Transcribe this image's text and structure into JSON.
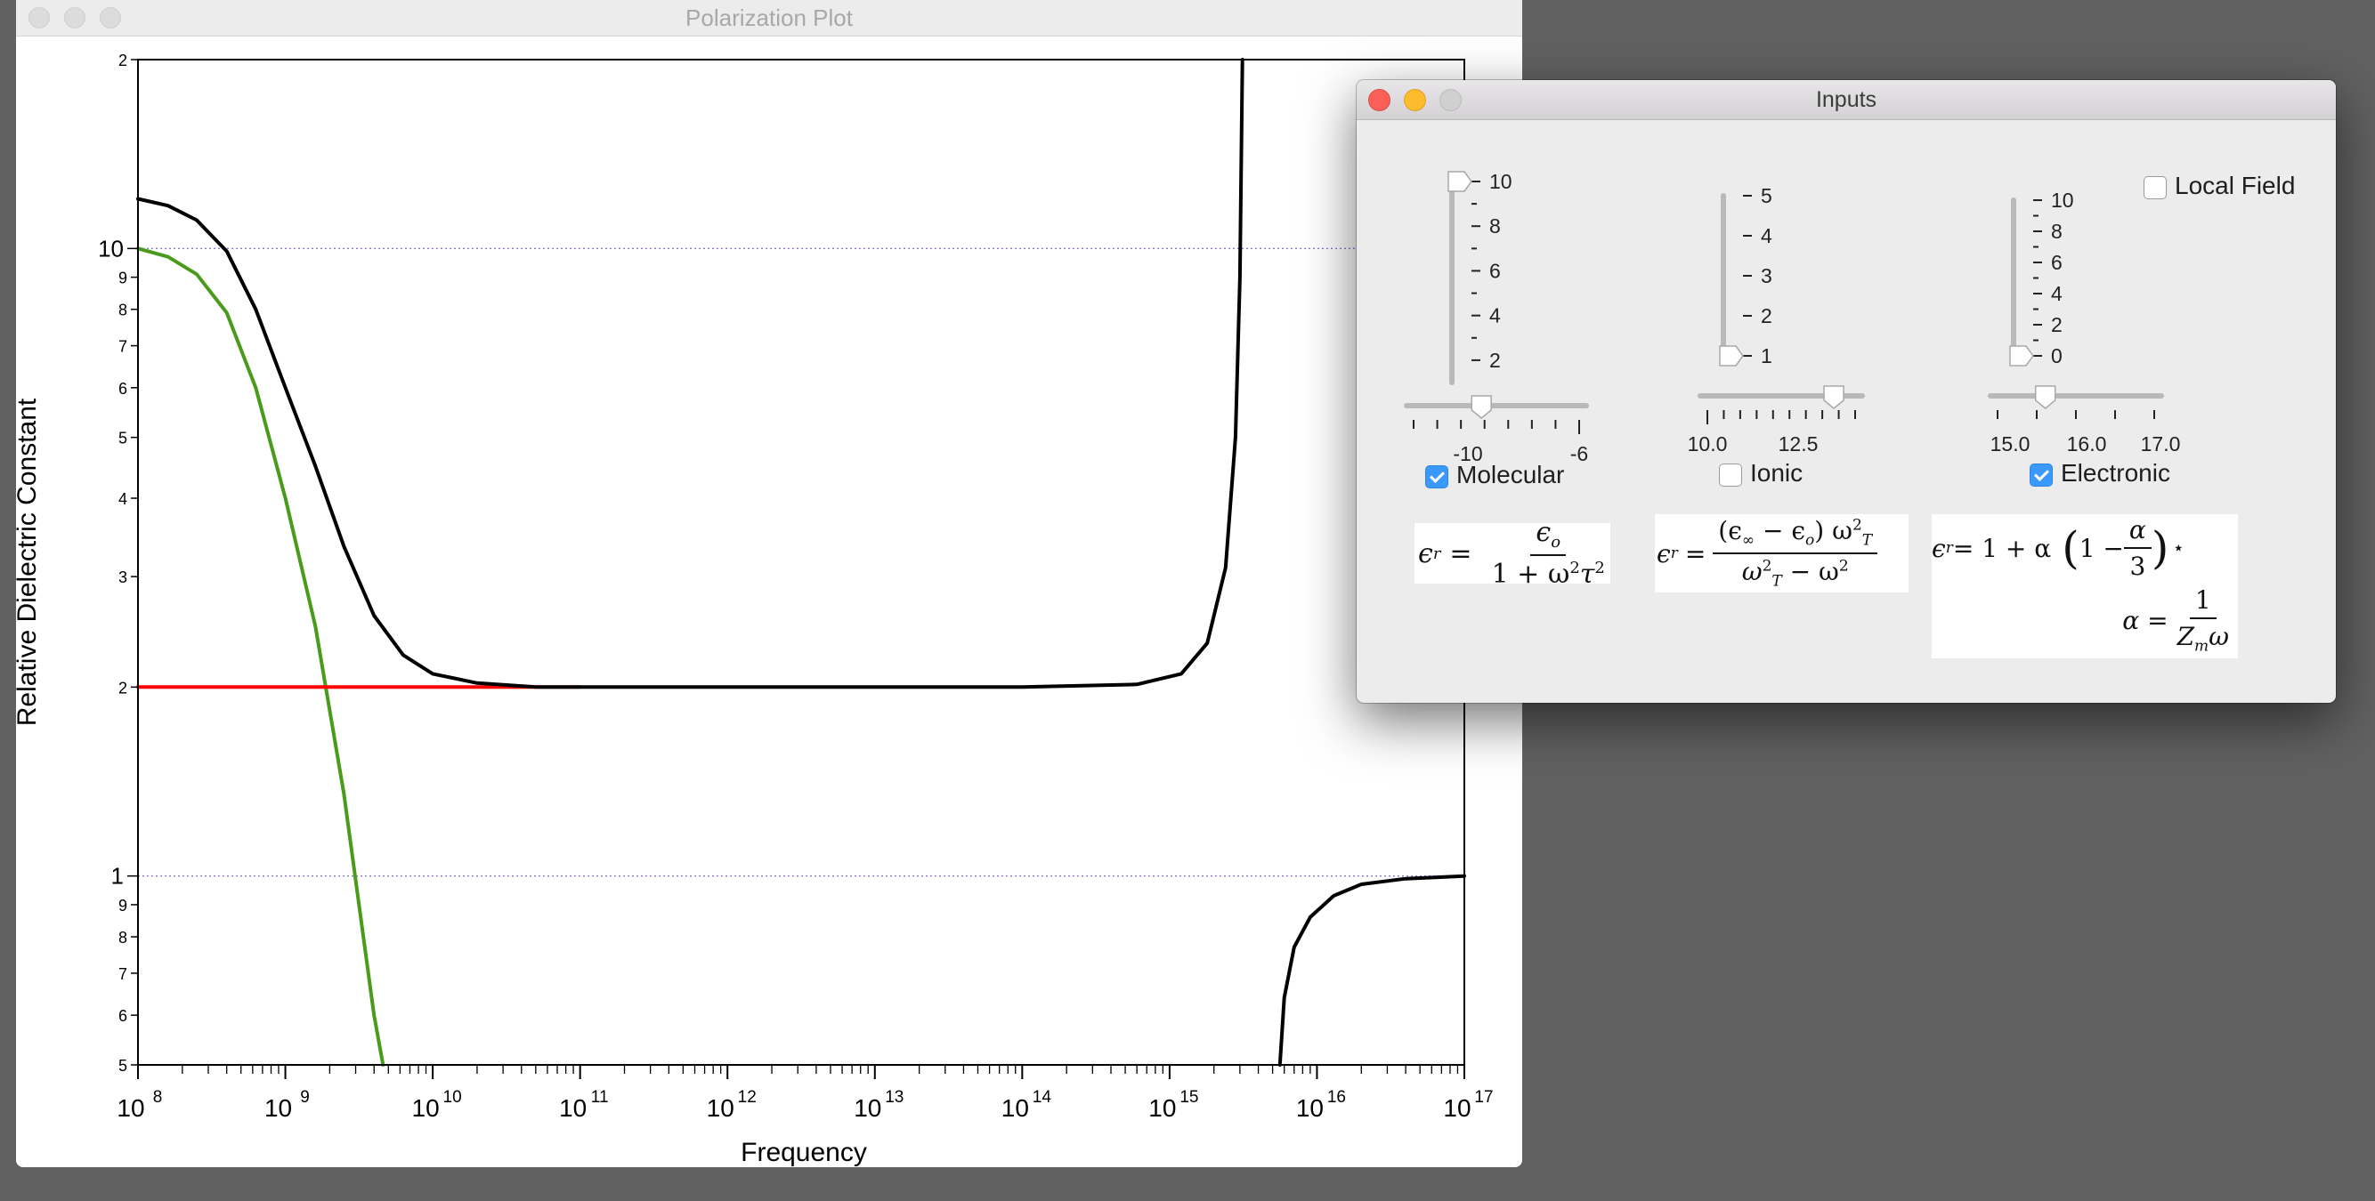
{
  "plot_window": {
    "title": "Polarization Plot",
    "chart_data": {
      "type": "line",
      "xlabel": "Frequency",
      "ylabel": "Relative Dielectric Constant",
      "x_scale": "log",
      "y_scale": "log",
      "xlim": [
        100000000.0,
        1e+17
      ],
      "ylim": [
        0.5,
        20
      ],
      "x_tick_labels": [
        {
          "base": "10",
          "exp": "8"
        },
        {
          "base": "10",
          "exp": "9"
        },
        {
          "base": "10",
          "exp": "10"
        },
        {
          "base": "10",
          "exp": "11"
        },
        {
          "base": "10",
          "exp": "12"
        },
        {
          "base": "10",
          "exp": "13"
        },
        {
          "base": "10",
          "exp": "14"
        },
        {
          "base": "10",
          "exp": "15"
        },
        {
          "base": "10",
          "exp": "16"
        },
        {
          "base": "10",
          "exp": "17"
        }
      ],
      "y_tick_labels": [
        "2",
        "10",
        "9",
        "8",
        "7",
        "6",
        "5",
        "4",
        "3",
        "2",
        "1",
        "9",
        "8",
        "7",
        "6",
        "5"
      ],
      "y_gridlines": [
        10,
        1
      ],
      "series": [
        {
          "color": "#4a9a1c",
          "points": [
            [
              100000000.0,
              10
            ],
            [
              160000000.0,
              9.7
            ],
            [
              250000000.0,
              9.1
            ],
            [
              400000000.0,
              7.9
            ],
            [
              630000000.0,
              6.0
            ],
            [
              1000000000.0,
              4.0
            ],
            [
              1600000000.0,
              2.5
            ],
            [
              2500000000.0,
              1.35
            ],
            [
              4000000000.0,
              0.6
            ],
            [
              4600000000.0,
              0.5
            ]
          ]
        },
        {
          "color": "#ff0000",
          "points": [
            [
              100000000.0,
              2.0
            ],
            [
              30000000000.0,
              2.0
            ],
            [
              100000000000.0,
              2.0
            ]
          ]
        },
        {
          "color": "#000000",
          "points": [
            [
              100000000.0,
              12.0
            ],
            [
              160000000.0,
              11.7
            ],
            [
              250000000.0,
              11.1
            ],
            [
              400000000.0,
              9.9
            ],
            [
              630000000.0,
              8.0
            ],
            [
              1000000000.0,
              6.0
            ],
            [
              1600000000.0,
              4.5
            ],
            [
              2500000000.0,
              3.35
            ],
            [
              4000000000.0,
              2.6
            ],
            [
              6300000000.0,
              2.25
            ],
            [
              10000000000.0,
              2.1
            ],
            [
              20000000000.0,
              2.03
            ],
            [
              50000000000.0,
              2.0
            ],
            [
              100000000000000.0,
              2.0
            ],
            [
              600000000000000.0,
              2.02
            ],
            [
              1200000000000000.0,
              2.1
            ],
            [
              1800000000000000.0,
              2.35
            ],
            [
              2400000000000000.0,
              3.1
            ],
            [
              2800000000000000.0,
              5.0
            ],
            [
              3000000000000000.0,
              9.0
            ],
            [
              3120000000000000.0,
              20.0
            ]
          ]
        },
        {
          "color": "#000000",
          "points": [
            [
              5600000000000000.0,
              0.5
            ],
            [
              6000000000000000.0,
              0.64
            ],
            [
              7000000000000000.0,
              0.77
            ],
            [
              9000000000000000.0,
              0.86
            ],
            [
              1.3e+16,
              0.93
            ],
            [
              2e+16,
              0.97
            ],
            [
              4e+16,
              0.99
            ],
            [
              1e+17,
              1.0
            ]
          ]
        }
      ]
    }
  },
  "inputs_window": {
    "title": "Inputs",
    "colors": {
      "close": "#fc5f57",
      "minimize": "#fdbc2e",
      "zoom": "#d0d0d0",
      "checkbox_checked": "#3b99fc"
    },
    "molecular": {
      "label": "Molecular",
      "checked": true,
      "vslider_ticks": [
        "10",
        "8",
        "6",
        "4",
        "2"
      ],
      "vslider_value": 10,
      "hslider_ticks": [
        "-10",
        "-6"
      ],
      "hslider_value": -9.5,
      "equation": {
        "lhs": "ϵ",
        "lhs_sub": "r",
        "eq": "=",
        "num": "ϵ",
        "num_sub": "o",
        "den_a": "1 + ω",
        "den_sup": "2",
        "den_b": "τ",
        "den_sup2": "2"
      }
    },
    "ionic": {
      "label": "Ionic",
      "checked": false,
      "vslider_ticks": [
        "5",
        "4",
        "3",
        "2",
        "1"
      ],
      "vslider_value": 1,
      "hslider_ticks": [
        "10.0",
        "12.5"
      ],
      "hslider_value": 13.2,
      "equation": {
        "lhs": "ϵ",
        "lhs_sub": "r",
        "eq": "=",
        "num_a": "(ϵ",
        "num_sub1": "∞",
        "num_b": " − ϵ",
        "num_sub2": "o",
        "num_c": ") ω",
        "num_sup": "2",
        "num_sub3": "T",
        "den_a": "ω",
        "den_sup": "2",
        "den_sub": "T",
        "den_b": " − ω",
        "den_sup2": "2"
      }
    },
    "electronic": {
      "label": "Electronic",
      "checked": true,
      "vslider_ticks": [
        "10",
        "8",
        "6",
        "4",
        "2",
        "0"
      ],
      "vslider_value": 0,
      "hslider_ticks": [
        "15.0",
        "16.0",
        "17.0"
      ],
      "hslider_value": 15.5,
      "equation": {
        "line1_a": "ϵ",
        "line1_sub": "r",
        "line1_b": " = 1 + α ",
        "paren_open": "(",
        "one_minus": "1 − ",
        "alpha": "α",
        "three": "3",
        "paren_close": ")",
        "star": "⋆",
        "line2_a": "α =",
        "line2_num": "1",
        "line2_den_a": "Z",
        "line2_den_sub": "m",
        "line2_den_b": "ω"
      }
    },
    "local_field": {
      "label": "Local Field",
      "checked": false
    }
  }
}
